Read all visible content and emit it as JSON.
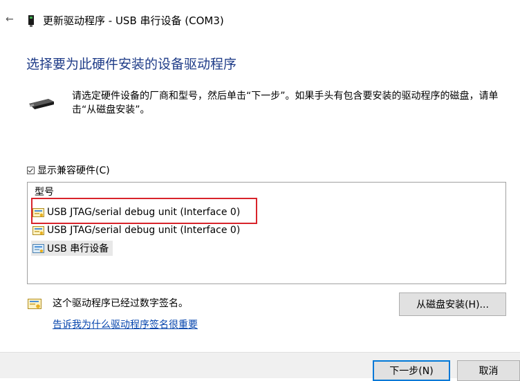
{
  "window": {
    "back_icon": "back-arrow-icon",
    "device_icon": "usb-device-icon",
    "title": "更新驱动程序 - USB 串行设备 (COM3)"
  },
  "main": {
    "heading": "选择要为此硬件安装的设备驱动程序",
    "description": "请选定硬件设备的厂商和型号，然后单击“下一步”。如果手头有包含要安装的驱动程序的磁盘，请单击“从磁盘安装”。",
    "show_compatible": {
      "label": "显示兼容硬件(C)",
      "checked": true
    },
    "model_list": {
      "header": "型号",
      "items": [
        {
          "label": "USB JTAG/serial debug unit (Interface 0)",
          "icon": "driver-cert-icon",
          "highlighted": true
        },
        {
          "label": "USB JTAG/serial debug unit (Interface 0)",
          "icon": "driver-cert-icon"
        },
        {
          "label": "USB 串行设备",
          "icon": "driver-cert-icon",
          "selected": true
        }
      ]
    },
    "signature": {
      "text": "这个驱动程序已经过数字签名。",
      "link": "告诉我为什么驱动程序签名很重要"
    },
    "have_disk_label": "从磁盘安装(H)..."
  },
  "footer": {
    "next_label": "下一步(N)",
    "cancel_label": "取消"
  },
  "colors": {
    "heading": "#1f3c88",
    "link": "#0645ad",
    "annotation_box": "#d8232a",
    "primary_border": "#0078d7",
    "selected_row": "#e8e8e8"
  }
}
